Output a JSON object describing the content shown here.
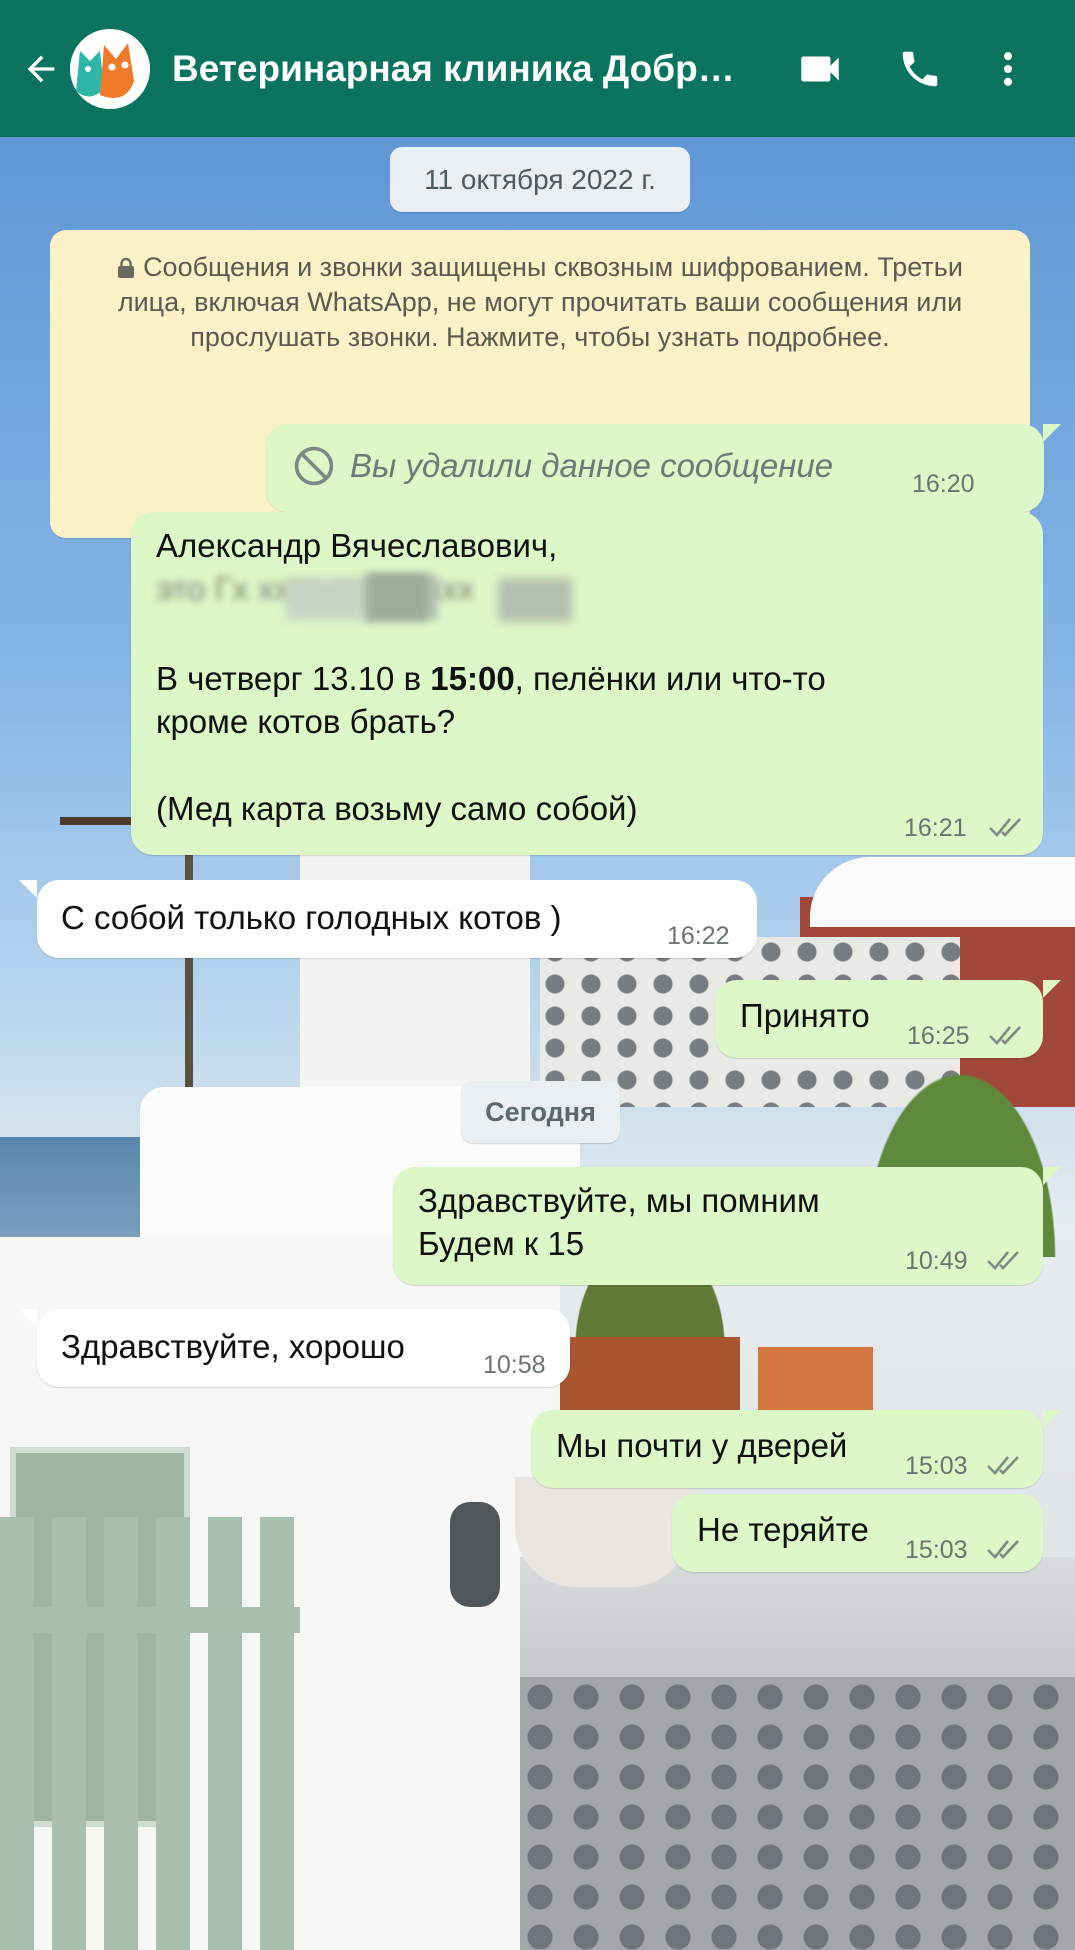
{
  "header": {
    "title": "Ветеринарная клиника Добрый доктор",
    "back_icon": "arrow-back-icon",
    "avatar_icon": "cats-logo-avatar",
    "video_icon": "videocam-icon",
    "call_icon": "phone-icon",
    "menu_icon": "more-vert-icon",
    "color": "#0b7461"
  },
  "chat": {
    "date_label": "11 октября 2022 г.",
    "encryption_notice": "Сообщения и звонки защищены сквозным шифрованием. Третьи лица, включая WhatsApp, не могут прочитать ваши сообщения или прослушать звонки. Нажмите, чтобы узнать подробнее.",
    "today_label": "Сегодня",
    "messages": [
      {
        "direction": "out",
        "text": "Вы удалили данное сообщение",
        "time": "16:20",
        "deleted": true
      },
      {
        "direction": "out",
        "lines": [
          "Александр Вячеславович,",
          "это Гх хххх ххххх ххх",
          "В четверг 13.10 в ",
          "15:00",
          ", пелёнки или что-то",
          "кроме котов брать?",
          "(Мед карта возьму само собой)"
        ],
        "time": "16:21",
        "read": true
      },
      {
        "direction": "in",
        "text": "С собой только голодных котов )",
        "time": "16:22"
      },
      {
        "direction": "out",
        "text": "Принято",
        "time": "16:25",
        "read": true
      },
      {
        "direction": "out",
        "lines": [
          "Здравствуйте, мы помним",
          "Будем к 15"
        ],
        "time": "10:49",
        "read": true
      },
      {
        "direction": "in",
        "text": "Здравствуйте, хорошо",
        "time": "10:58"
      },
      {
        "direction": "out",
        "text": "Мы почти у дверей",
        "time": "15:03",
        "read": true
      },
      {
        "direction": "out",
        "text": "Не теряйте",
        "time": "15:03",
        "read": true
      }
    ],
    "outgoing_color": "#dcf8c6",
    "incoming_color": "#ffffff",
    "read_tick_color": "#7f8c86"
  }
}
